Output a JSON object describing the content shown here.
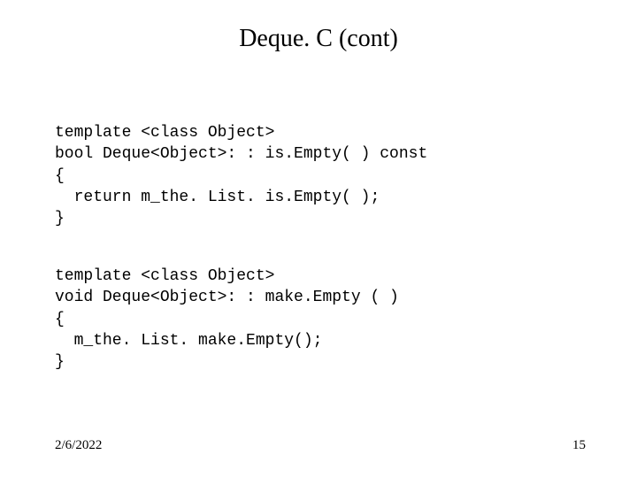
{
  "title": "Deque. C (cont)",
  "code1": "template <class Object>\nbool Deque<Object>: : is.Empty( ) const\n{\n  return m_the. List. is.Empty( );\n}",
  "code2": "template <class Object>\nvoid Deque<Object>: : make.Empty ( )\n{\n  m_the. List. make.Empty();\n}",
  "footer": {
    "date": "2/6/2022",
    "page": "15"
  }
}
